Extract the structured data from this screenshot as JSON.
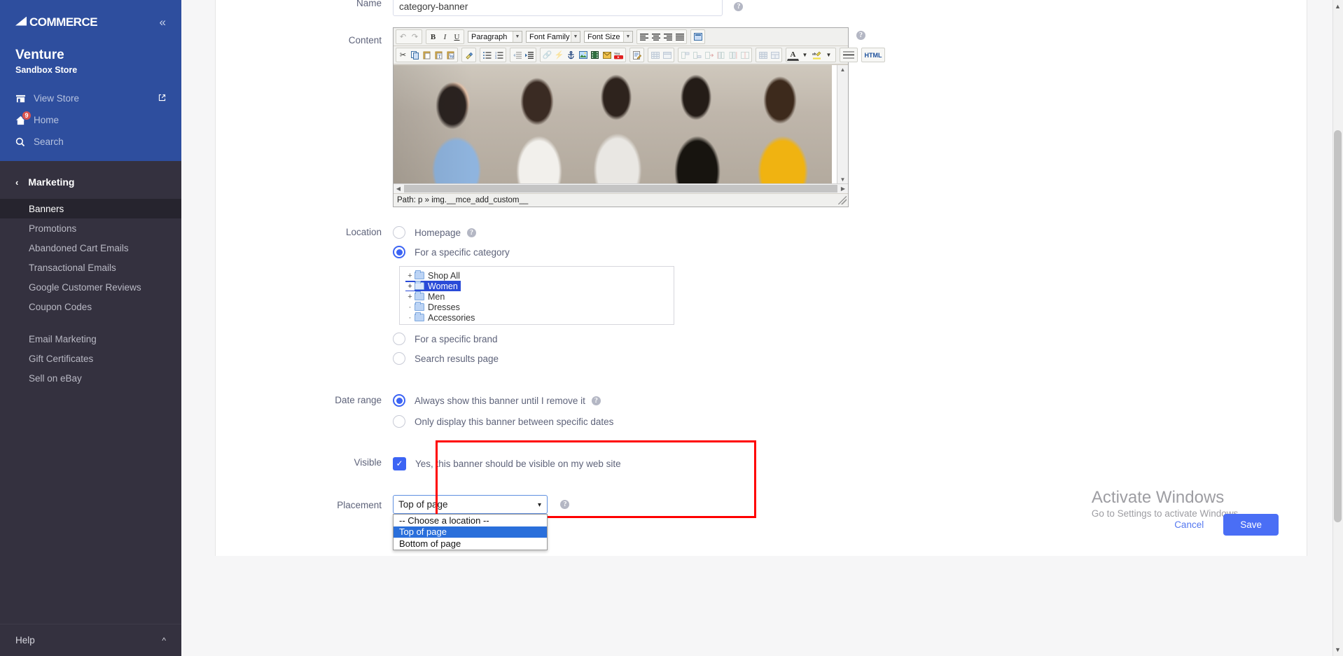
{
  "sidebar": {
    "logo_text": "COMMERCE",
    "logo_mark": "BIG",
    "collapse_icon": "double-chevron-left-icon",
    "store_name": "Venture",
    "store_subtitle": "Sandbox Store",
    "top_links": [
      {
        "label": "View Store",
        "icon": "storefront-icon",
        "external_icon": "external-link-icon",
        "badge": ""
      },
      {
        "label": "Home",
        "icon": "home-icon",
        "external_icon": "",
        "badge": "9"
      },
      {
        "label": "Search",
        "icon": "search-icon",
        "external_icon": "",
        "badge": ""
      }
    ],
    "section_title": "Marketing",
    "section_back_icon": "chevron-left-icon",
    "items_group_1": [
      {
        "label": "Banners",
        "active": true
      },
      {
        "label": "Promotions",
        "active": false
      },
      {
        "label": "Abandoned Cart Emails",
        "active": false
      },
      {
        "label": "Transactional Emails",
        "active": false
      },
      {
        "label": "Google Customer Reviews",
        "active": false
      },
      {
        "label": "Coupon Codes",
        "active": false
      }
    ],
    "items_group_2": [
      {
        "label": "Email Marketing",
        "active": false
      },
      {
        "label": "Gift Certificates",
        "active": false
      },
      {
        "label": "Sell on eBay",
        "active": false
      }
    ],
    "help_label": "Help",
    "help_caret": "chevron-up-icon"
  },
  "form": {
    "name": {
      "label": "Name",
      "value": "category-banner",
      "help_icon": "question-mark-icon"
    },
    "content": {
      "label": "Content",
      "help_icon": "question-mark-icon",
      "toolbar_row1": {
        "undo": "undo-icon",
        "redo": "redo-icon",
        "bold": "B",
        "italic": "I",
        "underline": "U",
        "format_select": "Paragraph",
        "fontfamily_select": "Font Family",
        "fontsize_select": "Font Size",
        "align_left": "align-left-icon",
        "align_center": "align-center-icon",
        "align_right": "align-right-icon",
        "align_justify": "align-justify-icon",
        "fullscreen": "fullscreen-icon"
      },
      "toolbar_row2": {
        "cut": "cut-icon",
        "copy": "copy-icon",
        "paste": "paste-icon",
        "paste_text": "paste-as-text-icon",
        "paste_word": "paste-from-word-icon",
        "cleanup": "cleanup-icon",
        "bullist": "bullet-list-icon",
        "numlist": "numbered-list-icon",
        "outdent": "outdent-icon",
        "indent": "indent-icon",
        "link": "link-icon",
        "unlink": "unlink-icon",
        "anchor": "anchor-icon",
        "image": "image-icon",
        "media": "media-icon",
        "email": "email-icon",
        "youtube": "youtube-icon",
        "edit_source": "edit-icon",
        "table": "table-icon",
        "table_props": "table-properties-icon",
        "row_props": "row-properties-icon",
        "cell_props": "cell-properties-icon",
        "row_insert": "insert-row-icon",
        "col_before": "insert-column-before-icon",
        "col_after": "insert-column-after-icon",
        "col_delete": "delete-column-icon",
        "table_grid": "table-grid-icon",
        "merge_cells": "merge-cells-icon",
        "forecolor": "A",
        "backcolor": "ab",
        "hr": "horizontal-rule-icon",
        "html": "HTML"
      },
      "path_text": "Path: p » img.__mce_add_custom__",
      "image_alt": "banner-image-five-women-with-sunglasses",
      "scroll_up": "▲",
      "scroll_down": "▼",
      "scroll_left": "◀",
      "scroll_right": "▶"
    },
    "location": {
      "label": "Location",
      "options": [
        {
          "label": "Homepage",
          "selected": false,
          "help_icon": "question-mark-icon"
        },
        {
          "label": "For a specific category",
          "selected": true,
          "help_icon": ""
        },
        {
          "label": "For a specific brand",
          "selected": false,
          "help_icon": ""
        },
        {
          "label": "Search results page",
          "selected": false,
          "help_icon": ""
        }
      ],
      "category_tree": [
        {
          "label": "Shop All",
          "expandable": true,
          "selected": false
        },
        {
          "label": "Women",
          "expandable": true,
          "selected": true
        },
        {
          "label": "Men",
          "expandable": true,
          "selected": false
        },
        {
          "label": "Dresses",
          "expandable": false,
          "selected": false
        },
        {
          "label": "Accessories",
          "expandable": false,
          "selected": false
        }
      ]
    },
    "date_range": {
      "label": "Date range",
      "options": [
        {
          "label": "Always show this banner until I remove it",
          "selected": true,
          "help_icon": "question-mark-icon"
        },
        {
          "label": "Only display this banner between specific dates",
          "selected": false,
          "help_icon": ""
        }
      ]
    },
    "visible": {
      "label": "Visible",
      "checkbox_label": "Yes, this banner should be visible on my web site",
      "checked": true,
      "check_glyph": "✓"
    },
    "placement": {
      "label": "Placement",
      "selected_value": "Top of page",
      "help_icon": "question-mark-icon",
      "caret_icon": "chevron-down-icon",
      "options": [
        {
          "label": "-- Choose a location --",
          "highlighted": false
        },
        {
          "label": "Top of page",
          "highlighted": true
        },
        {
          "label": "Bottom of page",
          "highlighted": false
        }
      ],
      "highlight_color": "#ff0000"
    }
  },
  "footer": {
    "cancel_label": "Cancel",
    "save_label": "Save",
    "save_color": "#4a6ef5"
  },
  "watermark": {
    "line1": "Activate Windows",
    "line2": "Go to Settings to activate Windows."
  }
}
